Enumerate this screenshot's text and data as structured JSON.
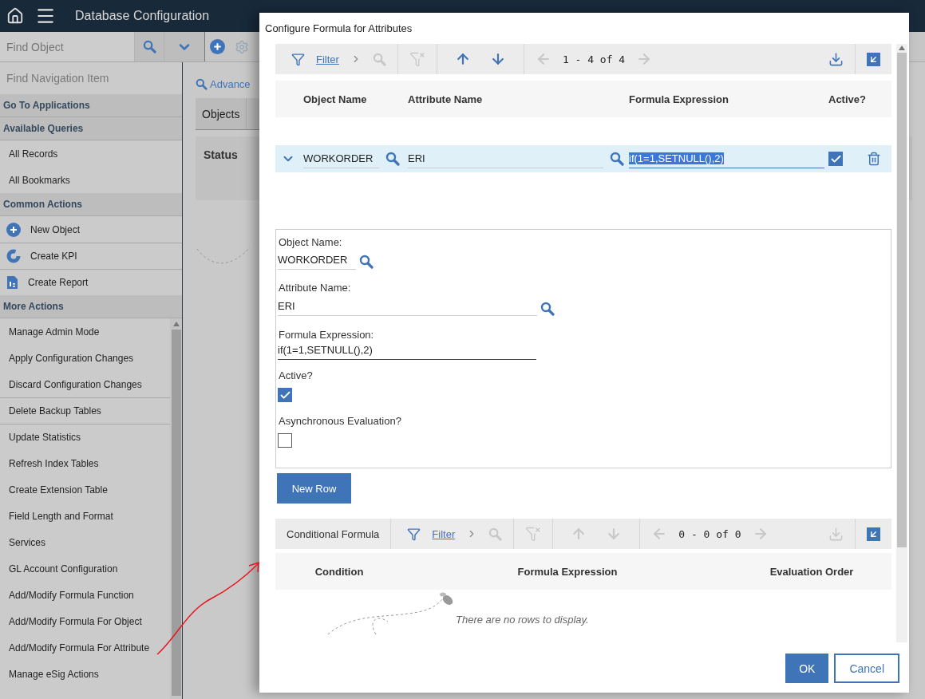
{
  "header": {
    "title": "Database Configuration"
  },
  "toolbar": {
    "search_placeholder": "Find Object"
  },
  "sidebar": {
    "search_placeholder": "Find Navigation Item",
    "sections": [
      {
        "title": "Go To Applications"
      },
      {
        "title": "Available Queries",
        "items": [
          {
            "label": "All Records",
            "kind": "plain",
            "separated": false
          },
          {
            "label": "All Bookmarks",
            "kind": "plain",
            "separated": false
          }
        ]
      },
      {
        "title": "Common Actions",
        "items": [
          {
            "label": "New Object",
            "kind": "add",
            "separated": false
          },
          {
            "label": "Create KPI",
            "kind": "kpi",
            "separated": true
          },
          {
            "label": "Create Report",
            "kind": "report",
            "separated": true
          }
        ]
      },
      {
        "title": "More Actions",
        "items": [
          {
            "label": "Manage Admin Mode",
            "kind": "plain",
            "separated": false
          },
          {
            "label": "Apply Configuration Changes",
            "kind": "plain",
            "separated": false
          },
          {
            "label": "Discard Configuration Changes",
            "kind": "plain",
            "separated": false
          },
          {
            "label": "Delete Backup Tables",
            "kind": "plain",
            "separated": true
          },
          {
            "label": "Update Statistics",
            "kind": "plain",
            "separated": true
          },
          {
            "label": "Refresh Index Tables",
            "kind": "plain",
            "separated": false
          },
          {
            "label": "Create Extension Table",
            "kind": "plain",
            "separated": false
          },
          {
            "label": "Field Length and Format",
            "kind": "plain",
            "separated": false
          },
          {
            "label": "Services",
            "kind": "plain",
            "separated": false
          },
          {
            "label": "GL Account Configuration",
            "kind": "plain",
            "separated": false
          },
          {
            "label": "Add/Modify Formula Function",
            "kind": "plain",
            "separated": false
          },
          {
            "label": "Add/Modify Formula For Object",
            "kind": "plain",
            "separated": false
          },
          {
            "label": "Add/Modify Formula For Attribute",
            "kind": "plain",
            "separated": false
          },
          {
            "label": "Manage eSig Actions",
            "kind": "plain",
            "separated": false
          }
        ]
      }
    ]
  },
  "main": {
    "advanced_link": "Advance",
    "tabs": [
      {
        "label": "Objects"
      }
    ],
    "status_label": "Status"
  },
  "dialog": {
    "title": "Configure Formula for Attributes",
    "table": {
      "filter": "Filter",
      "pagination": "1 - 4 of 4",
      "tools": [
        {
          "kind": "search",
          "disabled": true
        },
        {
          "kind": "clear-filter",
          "disabled": true
        },
        {
          "kind": "up",
          "disabled": false
        },
        {
          "kind": "down",
          "disabled": false
        },
        {
          "kind": "prev",
          "disabled": true
        },
        {
          "kind": "next",
          "disabled": true
        }
      ],
      "download_disabled": false,
      "columns": [
        "Object Name",
        "Attribute Name",
        "Formula Expression",
        "Active?"
      ],
      "rows": [
        {
          "object": "WORKORDER",
          "attribute": "ERI",
          "formula": "if(1=1,SETNULL(),2)",
          "formula_highlighted": true,
          "active": true,
          "expanded": true
        }
      ]
    },
    "detail": {
      "fields": [
        {
          "label": "Object Name:",
          "value": "WORKORDER",
          "kind": "short-lookup"
        },
        {
          "label": "Attribute Name:",
          "value": "ERI",
          "kind": "lookup"
        },
        {
          "label": "Formula Expression:",
          "value": "if(1=1,SETNULL(),2)",
          "kind": "text"
        }
      ],
      "checkboxes": [
        {
          "label": "Active?",
          "checked": true
        },
        {
          "label": "Asynchronous Evaluation?",
          "checked": false
        }
      ]
    },
    "new_row_button": "New Row",
    "conditional": {
      "title": "Conditional Formula",
      "filter": "Filter",
      "pagination": "0 - 0 of 0",
      "tools": [
        {
          "kind": "search",
          "disabled": true
        },
        {
          "kind": "clear-filter",
          "disabled": true
        },
        {
          "kind": "up",
          "disabled": true
        },
        {
          "kind": "down",
          "disabled": true
        },
        {
          "kind": "prev",
          "disabled": true
        },
        {
          "kind": "next",
          "disabled": true
        }
      ],
      "download_disabled": true,
      "columns": [
        "Condition",
        "Formula Expression",
        "Evaluation Order"
      ],
      "empty_message": "There are no rows to display."
    },
    "buttons": [
      {
        "label": "OK",
        "kind": "primary"
      },
      {
        "label": "Cancel",
        "kind": "secondary"
      }
    ]
  }
}
